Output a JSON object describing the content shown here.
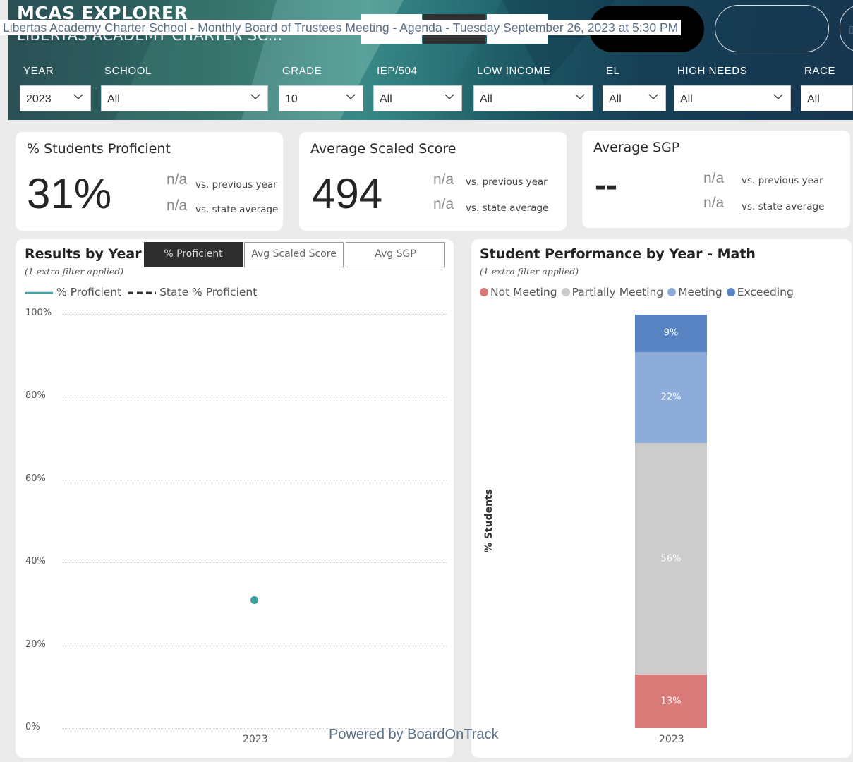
{
  "overlay": {
    "meeting_title": "Libertas Academy Charter School - Monthly Board of Trustees Meeting - Agenda - Tuesday September 26, 2023 at 5:30 PM",
    "powered_by": "Powered by BoardOnTrack"
  },
  "header": {
    "app_title": "MCAS EXPLORER",
    "school_name": "LIBERTAS ACADEMY CHARTER SC..."
  },
  "filters": [
    {
      "label": "YEAR",
      "value": "2023"
    },
    {
      "label": "SCHOOL",
      "value": "All"
    },
    {
      "label": "GRADE",
      "value": "10"
    },
    {
      "label": "IEP/504",
      "value": "All"
    },
    {
      "label": "LOW INCOME",
      "value": "All"
    },
    {
      "label": "EL",
      "value": "All"
    },
    {
      "label": "HIGH NEEDS",
      "value": "All"
    },
    {
      "label": "RACE",
      "value": "All"
    }
  ],
  "kpis": [
    {
      "title": "% Students Proficient",
      "value": "31%",
      "prev_na": "n/a",
      "prev_note": "vs. previous year",
      "state_na": "n/a",
      "state_note": "vs. state average"
    },
    {
      "title": "Average Scaled Score",
      "value": "494",
      "prev_na": "n/a",
      "prev_note": "vs. previous year",
      "state_na": "n/a",
      "state_note": "vs. state average"
    },
    {
      "title": "Average SGP",
      "value": "--",
      "prev_na": "n/a",
      "prev_note": "vs. previous year",
      "state_na": "n/a",
      "state_note": "vs. state average"
    }
  ],
  "results_panel": {
    "title": "Results by Year",
    "subtitle": "(1 extra filter applied)",
    "toggles": [
      "% Proficient",
      "Avg Scaled Score",
      "Avg SGP"
    ],
    "active_toggle": "% Proficient",
    "legend": {
      "solid": "% Proficient",
      "dashed": "State % Proficient"
    }
  },
  "performance_panel": {
    "title": "Student Performance by Year - Math",
    "subtitle": "(1 extra filter applied)",
    "ylabel": "% Students"
  },
  "colors": {
    "teal": "#3aa3a0",
    "not_meeting": "#d97a78",
    "partially_meeting": "#cccccc",
    "meeting": "#8eacd9",
    "exceeding": "#5884c4"
  },
  "chart_data": [
    {
      "type": "line",
      "title": "Results by Year",
      "x": [
        "2023"
      ],
      "series": [
        {
          "name": "% Proficient",
          "values": [
            31
          ]
        },
        {
          "name": "State % Proficient",
          "values": [
            null
          ]
        }
      ],
      "yticks": [
        "100%",
        "80%",
        "60%",
        "40%",
        "20%",
        "0%"
      ],
      "ylim": [
        0,
        100
      ],
      "grid": true,
      "legend": "top-left"
    },
    {
      "type": "bar",
      "title": "Student Performance by Year - Math",
      "categories": [
        "2023"
      ],
      "ylabel": "% Students",
      "stacked": true,
      "series": [
        {
          "name": "Not Meeting",
          "values": [
            13
          ],
          "label": "13%"
        },
        {
          "name": "Partially Meeting",
          "values": [
            56
          ],
          "label": "56%"
        },
        {
          "name": "Meeting",
          "values": [
            22
          ],
          "label": "22%"
        },
        {
          "name": "Exceeding",
          "values": [
            9
          ],
          "label": "9%"
        }
      ],
      "legend": "top-left"
    }
  ]
}
